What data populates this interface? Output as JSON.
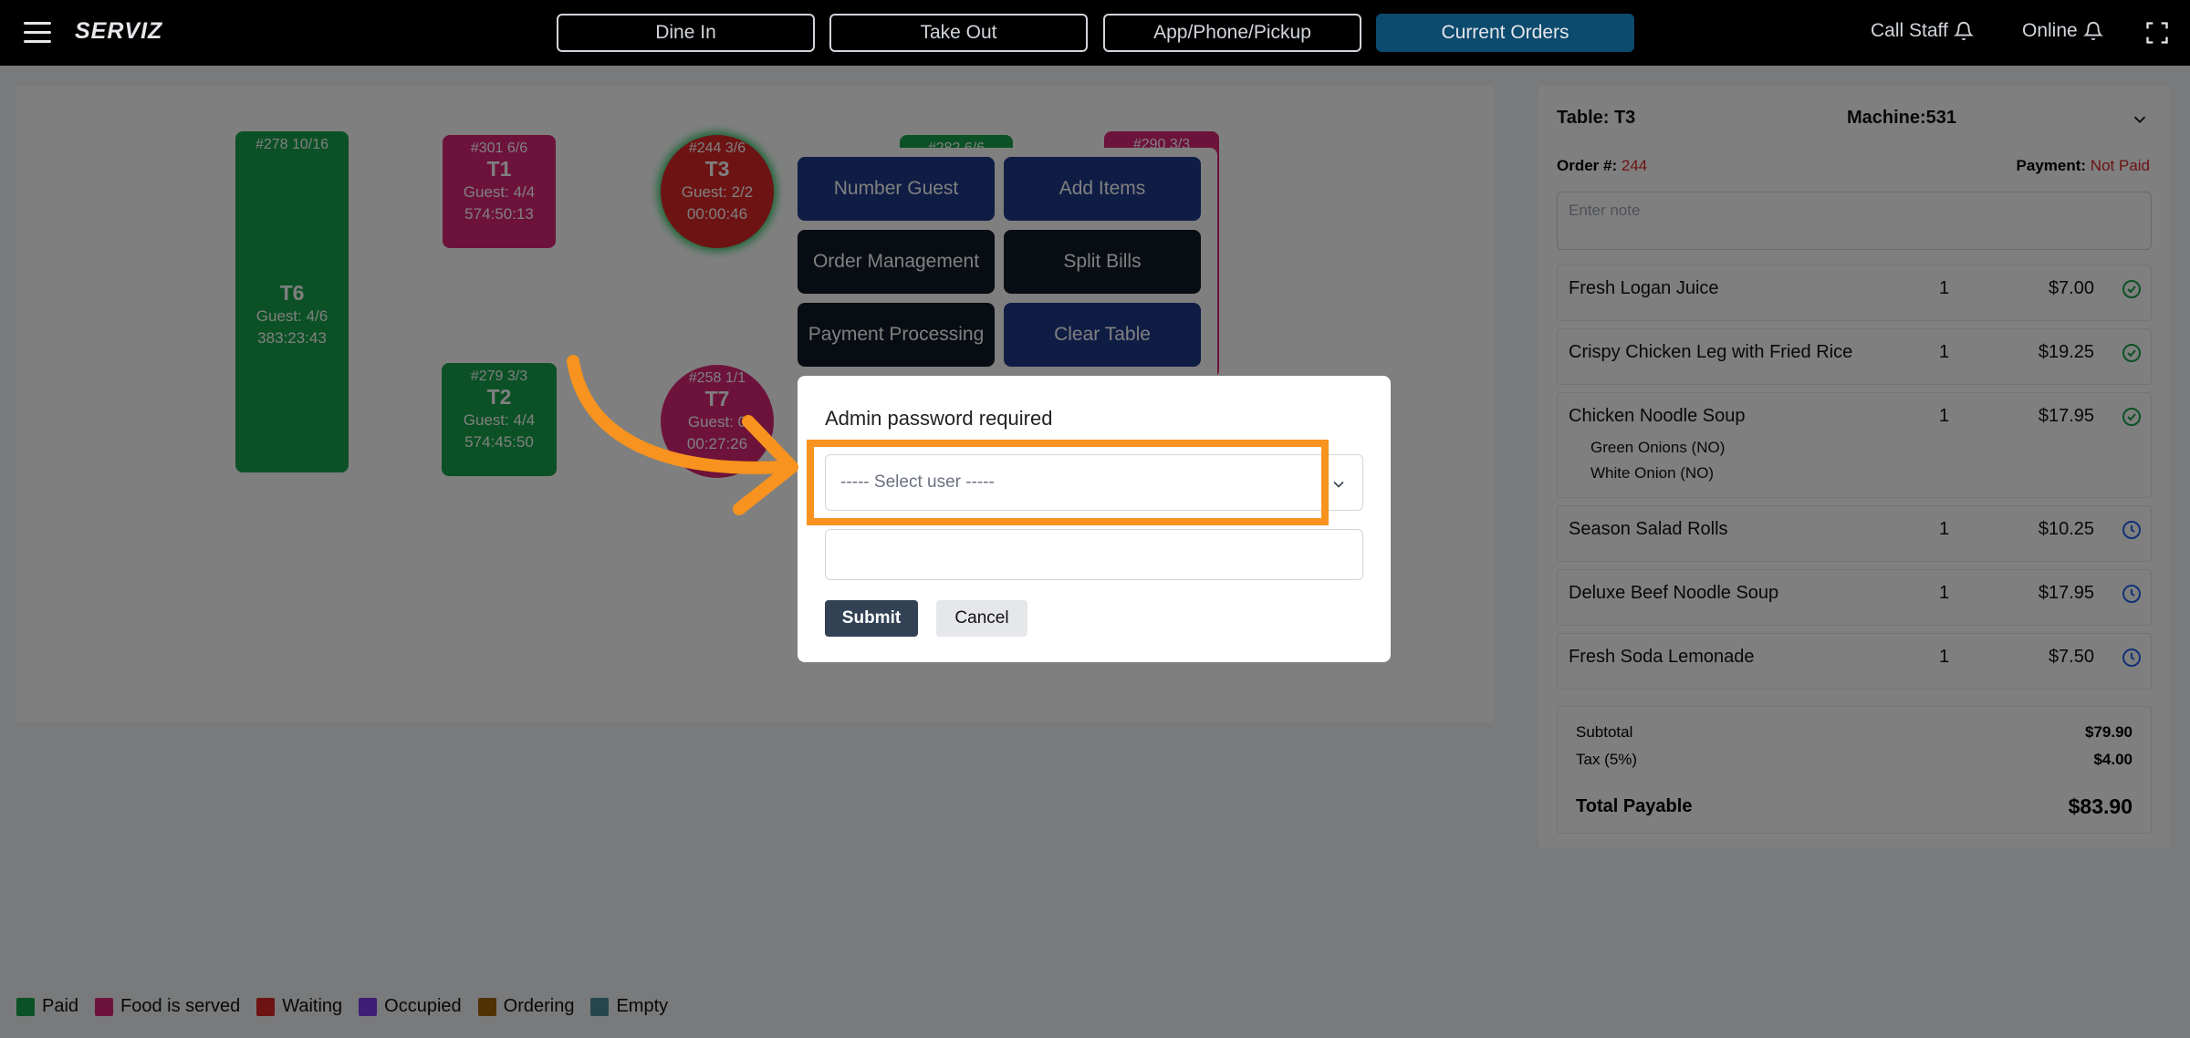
{
  "topbar": {
    "brand": "SERVIZ",
    "nav": [
      "Dine In",
      "Take Out",
      "App/Phone/Pickup",
      "Current Orders"
    ],
    "call_staff": "Call Staff",
    "online": "Online"
  },
  "tables": [
    {
      "num": "#278  10/16",
      "name": "T6",
      "guest": "Guest: 4/6",
      "time": "383:23:43"
    },
    {
      "num": "#301  6/6",
      "name": "T1",
      "guest": "Guest: 4/4",
      "time": "574:50:13"
    },
    {
      "num": "#244  3/6",
      "name": "T3",
      "guest": "Guest: 2/2",
      "time": "00:00:46"
    },
    {
      "num": "#279  3/3",
      "name": "T2",
      "guest": "Guest: 4/4",
      "time": "574:45:50"
    },
    {
      "num": "#258  1/1",
      "name": "T7",
      "guest": "Guest: 0",
      "time": "00:27:26"
    },
    {
      "num": "#282  6/6",
      "name": "",
      "guest": "",
      "time": ""
    },
    {
      "num": "#290  3/3",
      "name": "",
      "guest": "",
      "time": ""
    }
  ],
  "actions": [
    "Number Guest",
    "Add Items",
    "Order Management",
    "Split Bills",
    "Payment Processing",
    "Clear Table"
  ],
  "panel": {
    "table": "Table: T3",
    "machine": "Machine:531",
    "order_label": "Order #:",
    "order_num": "244",
    "payment_label": "Payment:",
    "payment_status": "Not Paid",
    "note_placeholder": "Enter note",
    "items": [
      {
        "name": "Fresh Logan Juice",
        "qty": "1",
        "price": "$7.00",
        "status": "served"
      },
      {
        "name": "Crispy Chicken Leg with Fried Rice",
        "qty": "1",
        "price": "$19.25",
        "status": "served"
      },
      {
        "name": "Chicken Noodle Soup",
        "qty": "1",
        "price": "$17.95",
        "status": "served",
        "mods": [
          "Green Onions (NO)",
          "White Onion (NO)"
        ]
      },
      {
        "name": "Season Salad Rolls",
        "qty": "1",
        "price": "$10.25",
        "status": "pending"
      },
      {
        "name": "Deluxe Beef Noodle Soup",
        "qty": "1",
        "price": "$17.95",
        "status": "pending"
      },
      {
        "name": "Fresh Soda Lemonade",
        "qty": "1",
        "price": "$7.50",
        "status": "pending"
      }
    ],
    "subtotal_label": "Subtotal",
    "subtotal": "$79.90",
    "tax_label": "Tax (5%)",
    "tax": "$4.00",
    "total_label": "Total Payable",
    "total": "$83.90"
  },
  "legend": [
    {
      "label": "Paid",
      "color": "#16a34a"
    },
    {
      "label": "Food is served",
      "color": "#db2777"
    },
    {
      "label": "Waiting",
      "color": "#dc2626"
    },
    {
      "label": "Occupied",
      "color": "#7c3aed"
    },
    {
      "label": "Ordering",
      "color": "#a16207"
    },
    {
      "label": "Empty",
      "color": "#4b8d9e"
    }
  ],
  "modal": {
    "title": "Admin password required",
    "select_placeholder": "----- Select user -----",
    "submit": "Submit",
    "cancel": "Cancel"
  },
  "colors": {
    "highlight": "#f7931e",
    "active_nav": "#0c4a6e",
    "payment_status": "#dc2626"
  }
}
